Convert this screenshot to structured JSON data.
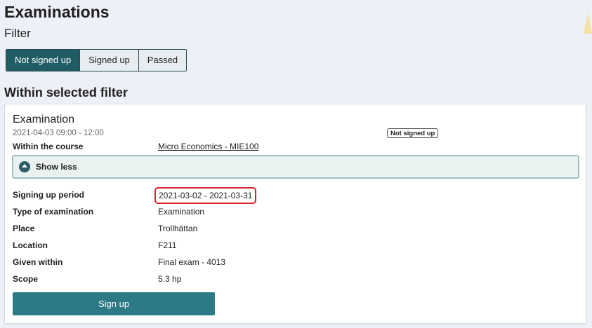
{
  "page": {
    "title": "Examinations",
    "filter_title": "Filter",
    "section_title": "Within selected filter"
  },
  "filters": [
    {
      "label": "Not signed up",
      "active": true
    },
    {
      "label": "Signed up",
      "active": false
    },
    {
      "label": "Passed",
      "active": false
    }
  ],
  "card": {
    "title": "Examination",
    "datetime": "2021-04-03 09:00 - 12:00",
    "status": "Not signed up",
    "course_label": "Within the course",
    "course_value": "Micro Economics - MIE100",
    "toggle_label": "Show less",
    "details": {
      "signing_up_period": {
        "label": "Signing up period",
        "value": "2021-03-02 - 2021-03-31"
      },
      "type_of_examination": {
        "label": "Type of examination",
        "value": "Examination"
      },
      "place": {
        "label": "Place",
        "value": "Trollhättan"
      },
      "location": {
        "label": "Location",
        "value": "F211"
      },
      "given_within": {
        "label": "Given within",
        "value": "Final exam - 4013"
      },
      "scope": {
        "label": "Scope",
        "value": "5.3 hp"
      }
    },
    "signup_button": "Sign up"
  },
  "colors": {
    "primary": "#1f5c64",
    "button": "#2c7a85",
    "highlight": "#d9202b",
    "link": "#1f5c9a",
    "background": "#eef0f7"
  },
  "icons": {
    "toggle": "chevron-up-icon"
  }
}
